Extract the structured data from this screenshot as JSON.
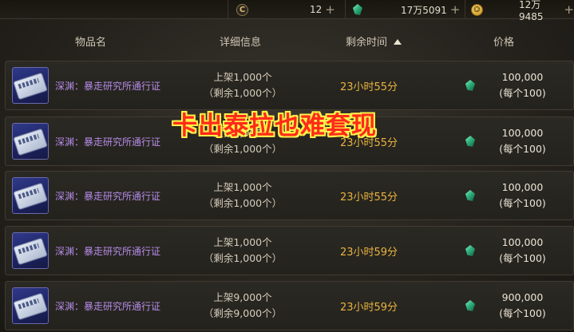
{
  "currency_bar": {
    "coupon_icon": "coupon-c-icon",
    "coupon_amount": "12",
    "coupon_plus": "+",
    "gem_icon": "green-gem-icon",
    "gem_amount": "17万5091",
    "gem_plus": "+",
    "gold_icon": "gold-coin-icon",
    "gold_amount": "12万9485",
    "gold_plus": "+"
  },
  "columns": {
    "item_name": "物品名",
    "details": "详细信息",
    "remaining_time": "剩余时间",
    "price": "价格",
    "sort": "ascending"
  },
  "listings": [
    {
      "name": "深渊：暴走研究所通行证",
      "listed": "上架1,000个",
      "remaining": "（剩余1,000个）",
      "time": "23小时55分",
      "price": "100,000",
      "unit_price": "(每个100)"
    },
    {
      "name": "深渊：暴走研究所通行证",
      "listed": "上架1,000个",
      "remaining": "（剩余1,000个）",
      "time": "23小时55分",
      "price": "100,000",
      "unit_price": "(每个100)"
    },
    {
      "name": "深渊：暴走研究所通行证",
      "listed": "上架1,000个",
      "remaining": "（剩余1,000个）",
      "time": "23小时55分",
      "price": "100,000",
      "unit_price": "(每个100)"
    },
    {
      "name": "深渊：暴走研究所通行证",
      "listed": "上架1,000个",
      "remaining": "（剩余1,000个）",
      "time": "23小时59分",
      "price": "100,000",
      "unit_price": "(每个100)"
    },
    {
      "name": "深渊：暴走研究所通行证",
      "listed": "上架9,000个",
      "remaining": "（剩余9,000个）",
      "time": "23小时59分",
      "price": "900,000",
      "unit_price": "(每个100)"
    }
  ],
  "overlay_caption": "卡出泰拉也难套现",
  "colors": {
    "item_name": "#b48be8",
    "time": "#e9b440",
    "caption_fill": "#ff2a1a",
    "caption_outline": "#fff04a"
  }
}
